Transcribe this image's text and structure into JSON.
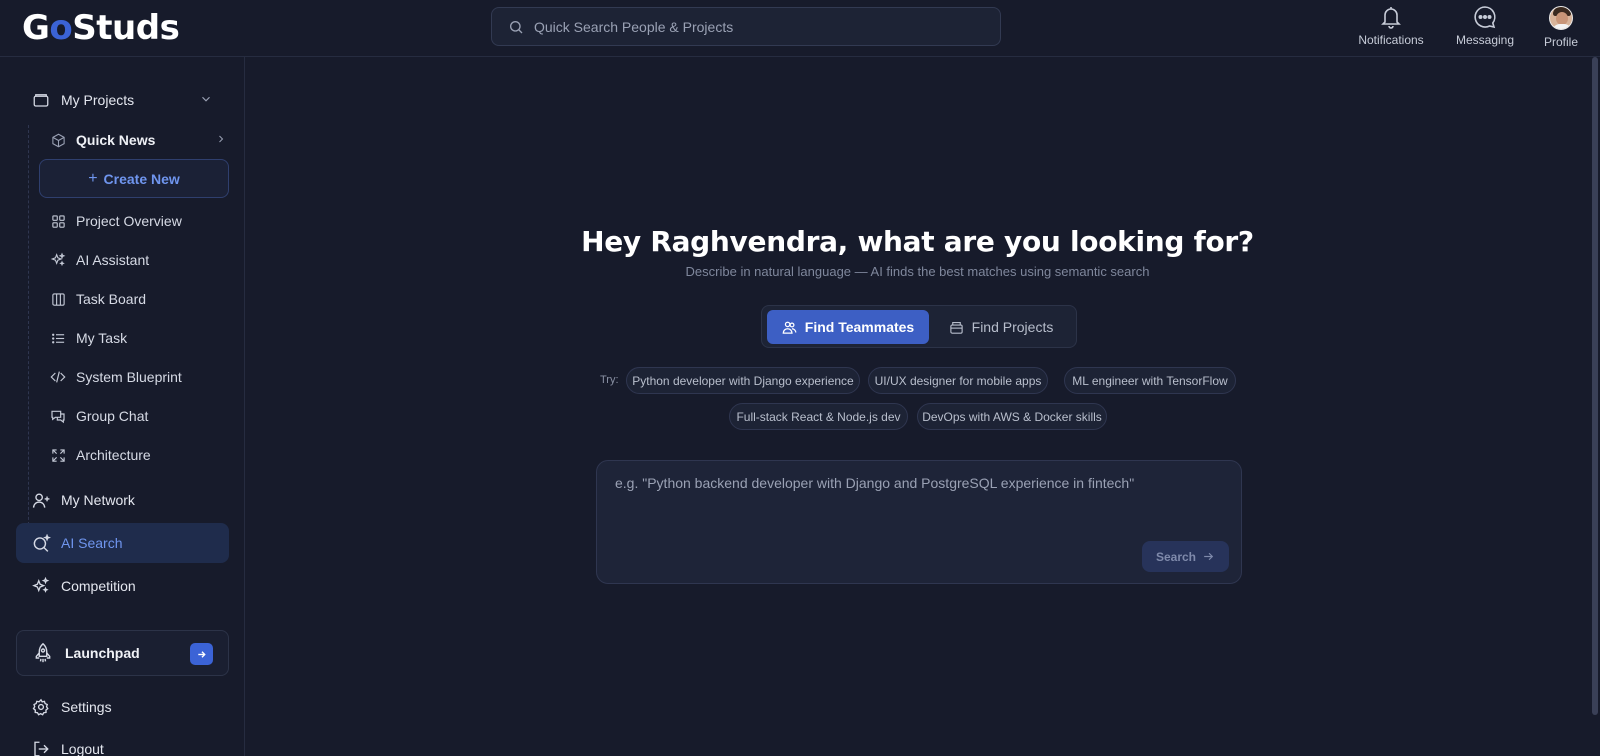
{
  "app": {
    "logo_prefix": "G",
    "logo_o": "o",
    "logo_suffix": "Studs"
  },
  "topbar": {
    "search_placeholder": "Quick Search People & Projects",
    "nav": [
      {
        "label": "Notifications",
        "icon": "bell-icon"
      },
      {
        "label": "Messaging",
        "icon": "chat-bubble-icon"
      },
      {
        "label": "Profile",
        "icon": "avatar"
      }
    ]
  },
  "sidebar": {
    "my_projects": "My Projects",
    "quick_news": "Quick News",
    "create_new": "Create New",
    "sub_items": [
      {
        "label": "Project Overview",
        "icon": "grid-icon"
      },
      {
        "label": "AI Assistant",
        "icon": "sparkles-icon"
      },
      {
        "label": "Task Board",
        "icon": "columns-icon"
      },
      {
        "label": "My Task",
        "icon": "list-icon"
      },
      {
        "label": "System Blueprint",
        "icon": "code-icon"
      },
      {
        "label": "Group Chat",
        "icon": "chat-icon"
      },
      {
        "label": "Architecture",
        "icon": "expand-icon"
      }
    ],
    "my_network": "My Network",
    "ai_search": "AI Search",
    "competition": "Competition",
    "launchpad": "Launchpad",
    "settings": "Settings",
    "logout": "Logout"
  },
  "main": {
    "title": "Hey Raghvendra, what are you looking for?",
    "subtitle": "Describe in natural language — AI finds the best matches using semantic search",
    "toggle": {
      "teammates": "Find Teammates",
      "projects": "Find Projects",
      "active": "teammates"
    },
    "try_label": "Try:",
    "suggestions": [
      "Python developer with Django experience",
      "UI/UX designer for mobile apps",
      "ML engineer with TensorFlow",
      "Full-stack React & Node.js dev",
      "DevOps with AWS & Docker skills"
    ],
    "query_placeholder": "e.g. \"Python backend developer with Django and PostgreSQL experience in fintech\"",
    "search_button": "Search"
  },
  "colors": {
    "background": "#171b2b",
    "accent": "#3d5fc4",
    "accent_text": "#6f95ee"
  }
}
